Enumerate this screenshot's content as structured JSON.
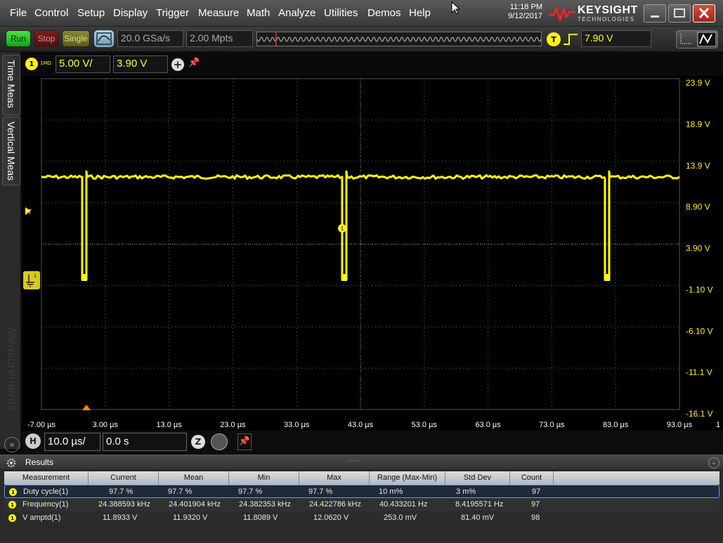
{
  "menu": {
    "items": [
      "File",
      "Control",
      "Setup",
      "Display",
      "Trigger",
      "Measure",
      "Math",
      "Analyze",
      "Utilities",
      "Demos",
      "Help"
    ]
  },
  "clock": {
    "time": "11:18 PM",
    "date": "9/12/2017"
  },
  "brand": {
    "name": "KEYSIGHT",
    "sub": "TECHNOLOGIES",
    "color": "#e8262a"
  },
  "toolbar": {
    "run_label": "Run",
    "stop_label": "Stop",
    "single_label": "Single",
    "sample_rate": "20.0 GSa/s",
    "memory_depth": "2.00 Mpts",
    "trigger_badge": "T",
    "trigger_level": "7.90 V"
  },
  "sidebar": {
    "tabs": [
      "Time Meas",
      "Vertical Meas"
    ],
    "watermark": "Measurements",
    "expand_label": "»"
  },
  "channel": {
    "number": "1",
    "impedance": "1MΩ",
    "scale": "5.00 V/",
    "offset": "3.90 V",
    "color": "#ffee22"
  },
  "plot": {
    "trigger_marker": "T",
    "ground_marker_label": "1",
    "y_labels": [
      "23.9 V",
      "18.9 V",
      "13.9 V",
      "8.90 V",
      "3.90 V",
      "-1.10 V",
      "-6.10 V",
      "-11.1 V",
      "-16.1 V"
    ],
    "x_labels": [
      "-7.00 µs",
      "3.00 µs",
      "13.0 µs",
      "23.0 µs",
      "33.0 µs",
      "43.0 µs",
      "53.0 µs",
      "63.0 µs",
      "73.0 µs",
      "83.0 µs",
      "93.0 µs"
    ],
    "x_overflow_label": "1",
    "trace_color": "#ffff00"
  },
  "timebase": {
    "badge": "H",
    "scale": "10.0 µs/",
    "position": "0.0 s",
    "zoom_badge": "Z"
  },
  "results": {
    "title": "Results",
    "grip": "·····",
    "columns": [
      "Measurement",
      "Current",
      "Mean",
      "Min",
      "Max",
      "Range (Max-Min)",
      "Std Dev",
      "Count"
    ],
    "rows": [
      {
        "badge": "1",
        "name": "Duty cycle(1)",
        "current": "97.7 %",
        "mean": "97.7 %",
        "min": "97.7 %",
        "max": "97.7 %",
        "range": "10 m%",
        "std": "3 m%",
        "count": "97"
      },
      {
        "badge": "1",
        "name": "Frequency(1)",
        "current": "24.388593 kHz",
        "mean": "24.401904 kHz",
        "min": "24.382353 kHz",
        "max": "24.422786 kHz",
        "range": "40.433201 Hz",
        "std": "8.4195571 Hz",
        "count": "97"
      },
      {
        "badge": "1",
        "name": "V amptd(1)",
        "current": "11.8933 V",
        "mean": "11.9320 V",
        "min": "11.8089 V",
        "max": "12.0620 V",
        "range": "253.0 mV",
        "std": "81.40 mV",
        "count": "98"
      }
    ]
  }
}
